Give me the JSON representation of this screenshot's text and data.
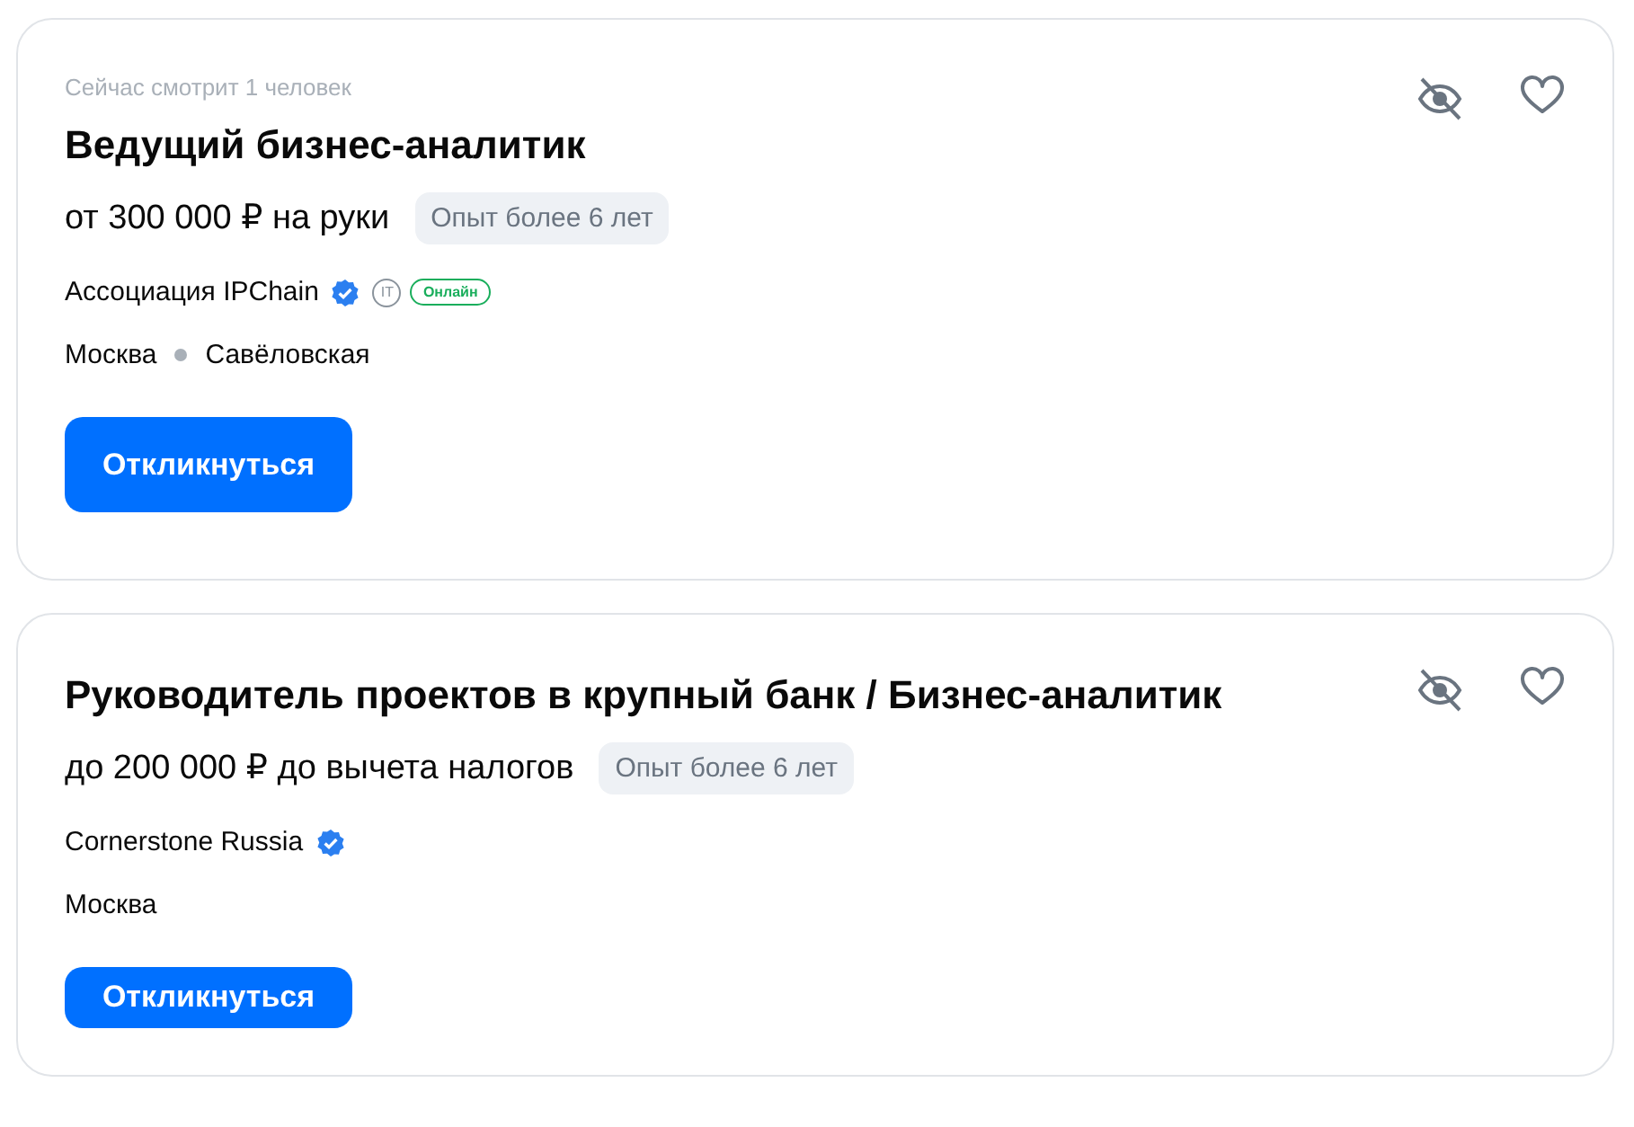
{
  "vacancies": [
    {
      "viewers": "Сейчас смотрит 1 человек",
      "title": "Ведущий бизнес-аналитик",
      "salary": "от 300 000 ₽ на руки",
      "experience": "Опыт более 6 лет",
      "company": "Ассоциация IPChain",
      "verified": true,
      "it_badge": "IT",
      "format_badge": "Онлайн",
      "city": "Москва",
      "metro": "Савёловская",
      "button": "Откликнуться"
    },
    {
      "title": "Руководитель проектов в крупный банк / Бизнес-аналитик",
      "salary": "до 200 000 ₽ до вычета налогов",
      "experience": "Опыт более 6 лет",
      "company": "Cornerstone Russia",
      "verified": true,
      "city": "Москва",
      "button": "Откликнуться"
    }
  ]
}
